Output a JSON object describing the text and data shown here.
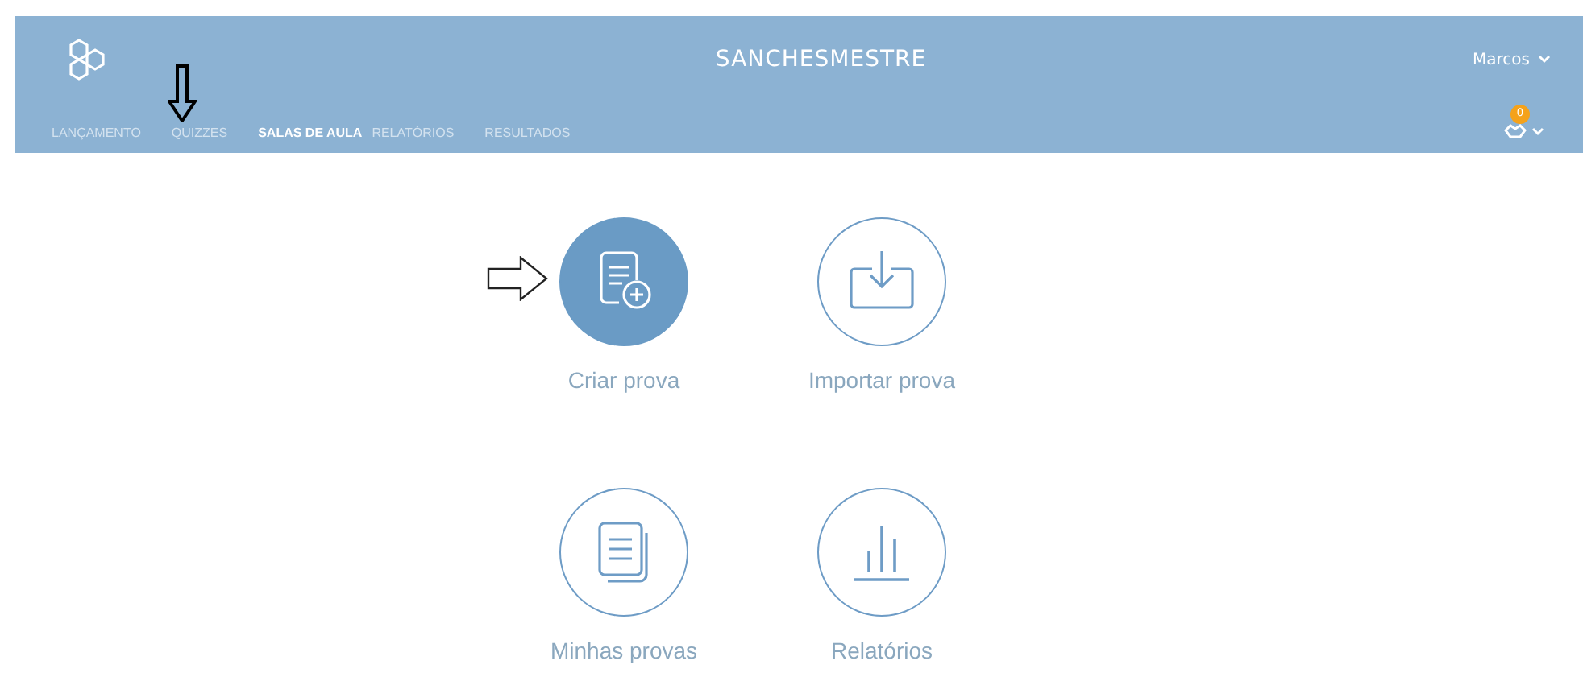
{
  "header": {
    "title": "SANCHESMESTRE",
    "user": "Marcos",
    "notification_count": "0"
  },
  "nav": [
    {
      "label": "LANÇAMENTO",
      "selected": false
    },
    {
      "label": "QUIZZES",
      "selected": false
    },
    {
      "label": "SALAS DE AULA",
      "selected": true
    },
    {
      "label": "RELATÓRIOS",
      "selected": false
    },
    {
      "label": "RESULTADOS",
      "selected": false
    }
  ],
  "tiles": [
    {
      "kind": "create",
      "label": "Criar prova",
      "selected": true
    },
    {
      "kind": "import",
      "label": "Importar prova",
      "selected": false
    },
    {
      "kind": "list",
      "label": "Minhas provas",
      "selected": false
    },
    {
      "kind": "report",
      "label": "Relatórios",
      "selected": false
    }
  ]
}
